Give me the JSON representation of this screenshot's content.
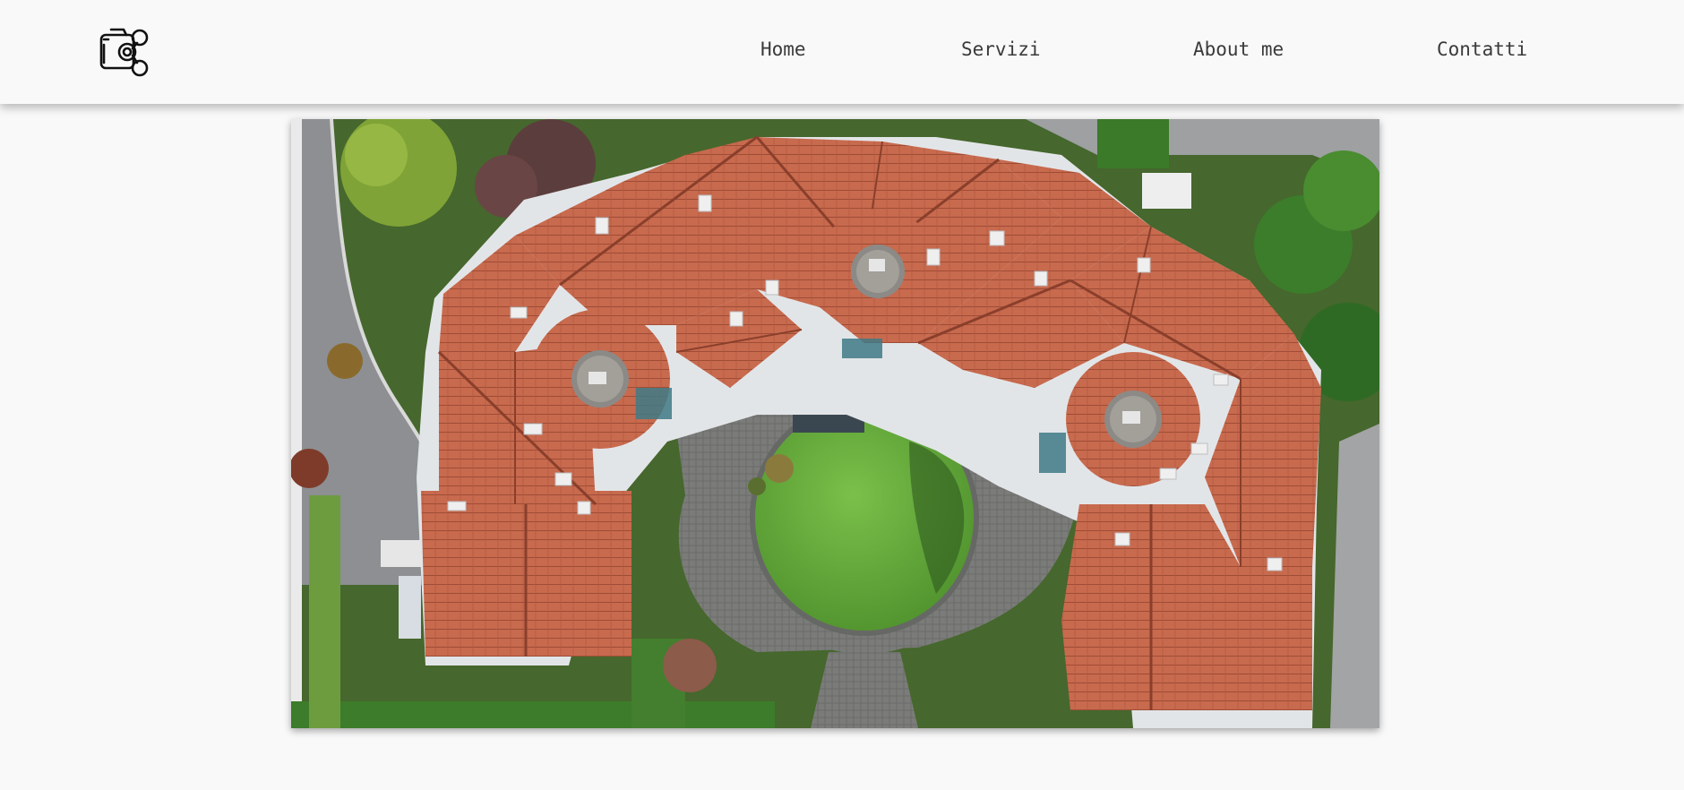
{
  "header": {
    "logo_icon": "camera-drone-icon",
    "nav": [
      {
        "label": "Home"
      },
      {
        "label": "Servizi"
      },
      {
        "label": "About me"
      },
      {
        "label": "Contatti"
      }
    ]
  },
  "main": {
    "photo_icon": "aerial-photo-image"
  },
  "colors": {
    "background": "#f9f9f9",
    "nav_text": "#3a3a3a",
    "roof": "#c96a4f",
    "lawn": "#5ea337"
  }
}
